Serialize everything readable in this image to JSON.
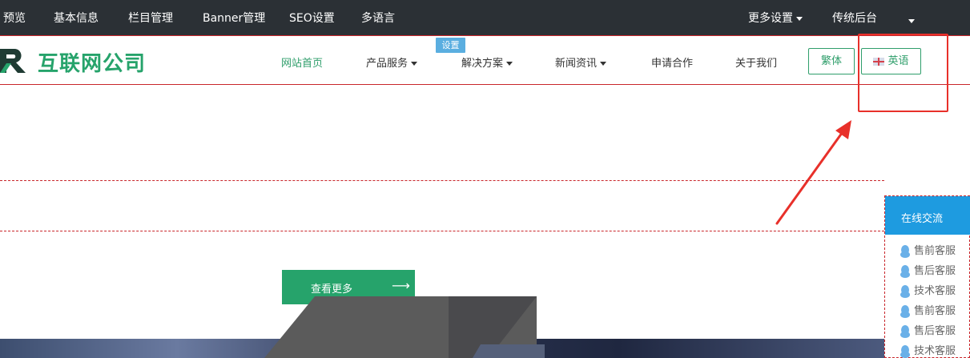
{
  "admin_bar": {
    "preview": "预览",
    "basic_info": "基本信息",
    "column_manage": "栏目管理",
    "banner_manage": "Banner管理",
    "seo_settings": "SEO设置",
    "multi_language": "多语言",
    "more_settings": "更多设置",
    "classic_backend": "传统后台"
  },
  "header": {
    "logo_text": "互联网公司",
    "settings_tag": "设置",
    "nav": [
      "网站首页",
      "产品服务",
      "解决方案",
      "新闻资讯",
      "申请合作",
      "关于我们"
    ],
    "lang_traditional": "繁体",
    "lang_english": "英语"
  },
  "hero": {
    "more_button": "查看更多",
    "more_arrow": "⟶"
  },
  "chat": {
    "title": "在线交流",
    "items": [
      "售前客服",
      "售后客服",
      "技术客服",
      "售前客服",
      "售后客服",
      "技术客服"
    ]
  },
  "colors": {
    "admin_bg": "#2b3035",
    "brand_green": "#26a36b",
    "chat_blue": "#1e9be0",
    "annotation_red": "#e8302a"
  }
}
